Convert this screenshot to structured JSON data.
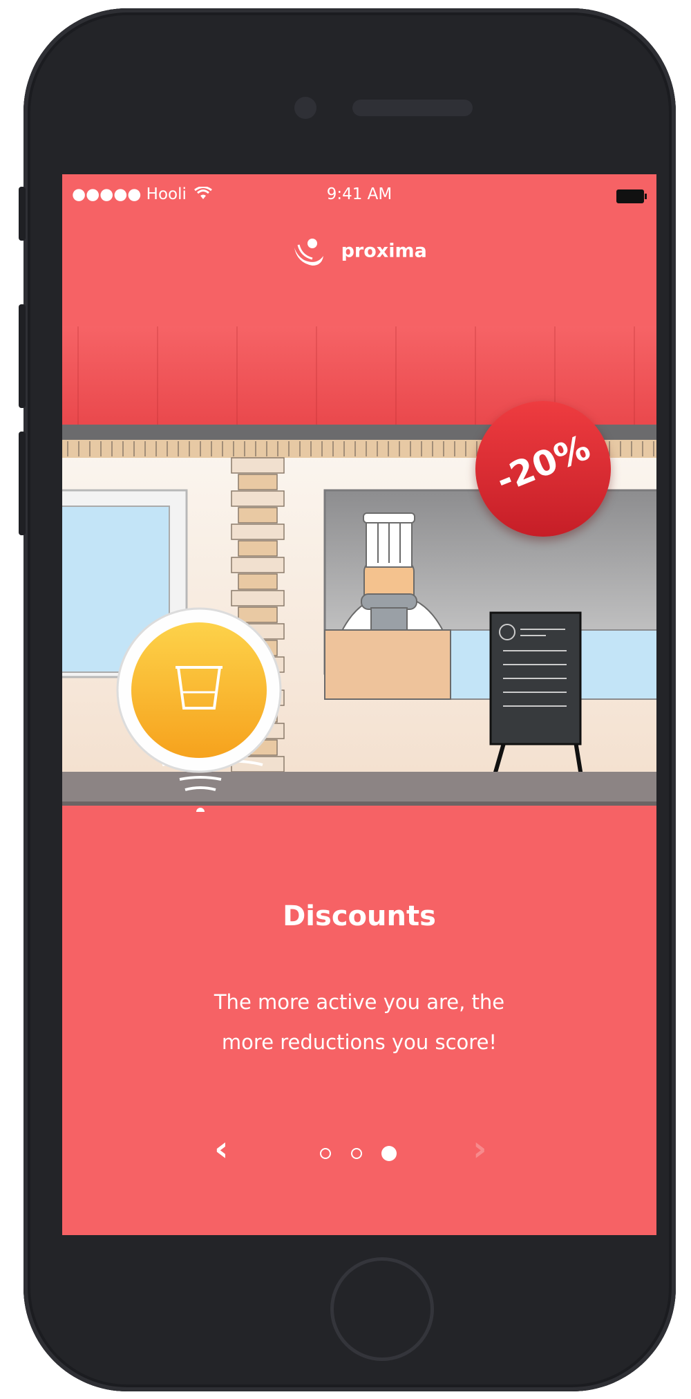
{
  "status_bar": {
    "carrier": "●●●●● Hooli",
    "wifi_icon": "wifi-icon",
    "time": "9:41 AM",
    "battery_icon": "battery-icon"
  },
  "brand": {
    "name": "proxima",
    "logo_icon": "proxima-logo-icon"
  },
  "illustration": {
    "badge": "-20%",
    "cup_icon": "cup-icon"
  },
  "slide": {
    "title": "Discounts",
    "body": "The more active you are, the more reductions you score!"
  },
  "pager": {
    "prev_icon": "chevron-left-icon",
    "next_icon": "chevron-right-icon",
    "count": 3,
    "active_index": 2
  },
  "colors": {
    "background": "#f66265",
    "awning": "#e9474b",
    "badge": "#d8282f",
    "cup": "#fbb22b"
  }
}
